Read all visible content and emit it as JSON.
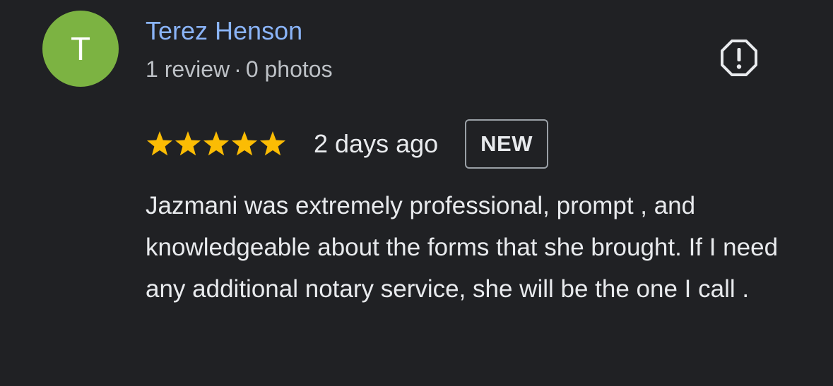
{
  "reviewer": {
    "avatar_initial": "T",
    "avatar_color": "#7cb342",
    "name": "Terez Henson",
    "review_count": "1 review",
    "separator": "·",
    "photo_count": "0 photos"
  },
  "report": {
    "icon": "report-flag-octagon-icon"
  },
  "review": {
    "rating": 5,
    "rating_max": 5,
    "star_color": "#fbbc04",
    "date": "2 days ago",
    "badge": "NEW",
    "text": "Jazmani was extremely professional, prompt , and knowledgeable about the forms that she brought. If I need any additional notary service, she will be the one I call ."
  }
}
